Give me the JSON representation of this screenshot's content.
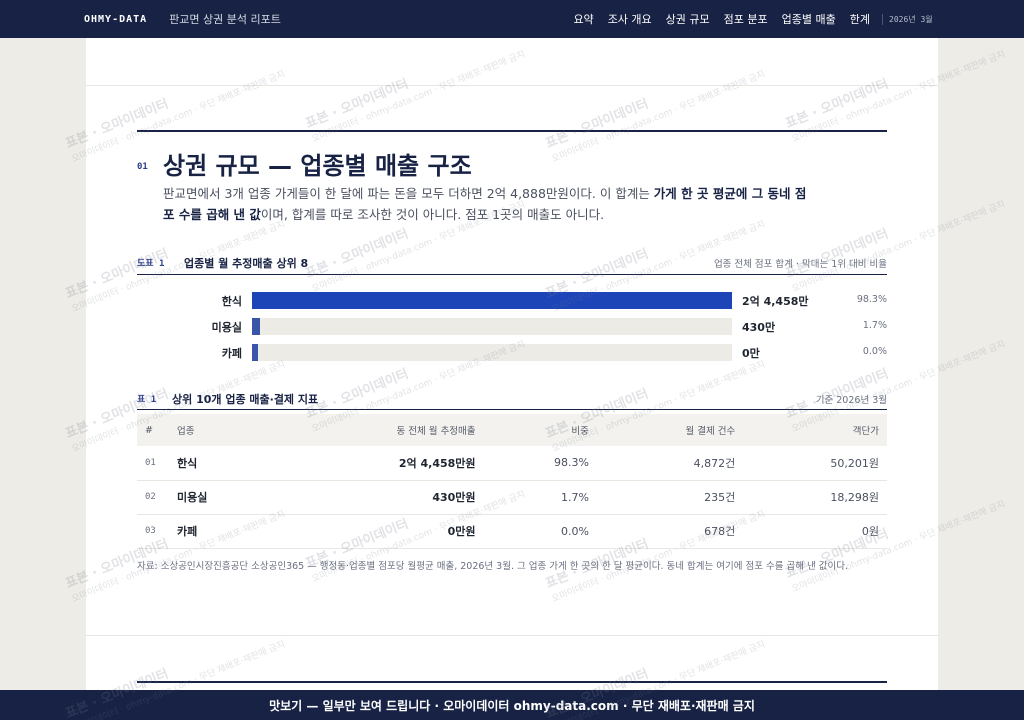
{
  "header": {
    "brand": "OHMY-DATA",
    "subtitle": "판교면 상권 분석 리포트",
    "nav": [
      "요약",
      "조사 개요",
      "상권 규모",
      "점포 분포",
      "업종별 매출",
      "한계"
    ],
    "date": "2026년 3월"
  },
  "section": {
    "number": "01",
    "title": "상권 규모 — 업종별 매출 구조",
    "desc_1": "판교면에서 3개 업종 가게들이 한 달에 파는 돈을 모두 더하면 2억 4,888만원이다. 이 합계는 ",
    "desc_bold": "가게 한 곳 평균에 그 동네 점포 수를 곱해 낸 값",
    "desc_2": "이며, 합계를 따로 조사한 것이 아니다. 점포 1곳의 매출도 아니다."
  },
  "figure": {
    "tag": "도표 1",
    "title": "업종별 월 추정매출 상위 8",
    "note": "업종 전체 점포 합계 · 막대는 1위 대비 비율"
  },
  "chart_data": {
    "type": "bar",
    "categories": [
      "한식",
      "미용실",
      "카페"
    ],
    "values": [
      24458,
      430,
      0
    ],
    "value_labels": [
      "2억 4,458만",
      "430만",
      "0만"
    ],
    "share_labels": [
      "98.3%",
      "1.7%",
      "0.0%"
    ],
    "bar_ratio": [
      1.0,
      0.0176,
      0.0
    ],
    "colors": {
      "top": "#1e45b8",
      "other": "#3a55a8",
      "track": "#ecebe6"
    }
  },
  "table": {
    "tag": "표 1",
    "title": "상위 10개 업종 매출·결제 지표",
    "note": "기준 2026년 3월",
    "columns": [
      "#",
      "업종",
      "동 전체 월 추정매출",
      "비중",
      "월 결제 건수",
      "객단가"
    ],
    "rows": [
      [
        "01",
        "한식",
        "2억 4,458만원",
        "98.3%",
        "4,872건",
        "50,201원"
      ],
      [
        "02",
        "미용실",
        "430만원",
        "1.7%",
        "235건",
        "18,298원"
      ],
      [
        "03",
        "카페",
        "0만원",
        "0.0%",
        "678건",
        "0원"
      ]
    ]
  },
  "source": "자료: 소상공인시장진흥공단 소상공인365 — 행정동·업종별 점포당 월평균 매출, 2026년 3월. 그 업종 가게 한 곳의 한 달 평균이다. 동네 합계는 여기에 점포 수를 곱해 낸 값이다.",
  "footer": "맛보기 — 일부만 보여 드립니다 · 오마이데이터 ohmy-data.com · 무단 재배포·재판매 금지",
  "watermark": {
    "main": "표본 · 오마이데이터",
    "sub": "오마이데이터 · ohmy-data.com · 무단 재배포·재판매 금지"
  }
}
